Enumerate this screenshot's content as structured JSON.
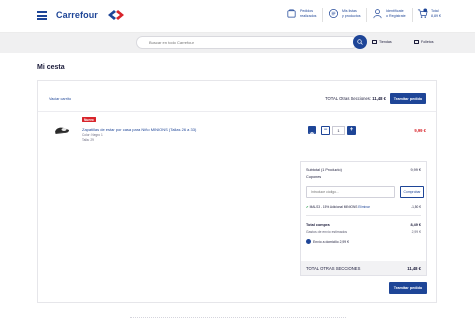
{
  "header": {
    "brand": "Carrefour",
    "nav": [
      {
        "line1": "Pedidos",
        "line2": "realizados",
        "icon": "orders-icon"
      },
      {
        "line1": "Mis listas",
        "line2": "y productos",
        "icon": "lists-icon"
      },
      {
        "line1": "Identifícate",
        "line2": "o Regístrate",
        "icon": "user-icon"
      },
      {
        "line1": "Total",
        "line2": "8,89 €",
        "icon": "cart-icon",
        "badge": "1"
      }
    ]
  },
  "search": {
    "placeholder": "Buscar en todo Carrefour",
    "links": [
      "Tiendas",
      "Folletos"
    ]
  },
  "page": {
    "title": "Mi cesta"
  },
  "cart": {
    "seller_link": "Vaciar carrito",
    "total_other_label": "TOTAL Otras Secciones:",
    "total_other_value": "11,48 €",
    "checkout_label": "Tramitar pedido",
    "item": {
      "badge": "Nuevo",
      "name": "Zapatillas de estar por casa para Niño MINIONS (Tallas 26 a 33)",
      "color": "Color: Negro 1",
      "size": "Talla: 29",
      "qty": "1",
      "price": "9,99 €"
    },
    "summary": {
      "subtotal_label": "Subtotal (1 Producto)",
      "subtotal_value": "9,99 €",
      "coupons_label": "Cupones",
      "coupon_placeholder": "Introduce código...",
      "check_label": "Comprobar",
      "promo_text": "MALS3 - 15% Adicional MINIONS",
      "promo_remove": "Eliminar",
      "promo_value": "-1,50 €",
      "total_purchase_label": "Total compra",
      "total_purchase_value": "8,49 €",
      "shipping_label": "Gastos de envío estimados",
      "shipping_value": "2,99 €",
      "home_delivery_label": "Envío a domicilio 2,99 €",
      "grand_total_label": "TOTAL OTRAS SECCIONES",
      "grand_total_value": "11,48 €"
    }
  },
  "colors": {
    "brand": "#1e4597",
    "sale": "#d8242b",
    "success": "#2e9e4f"
  }
}
